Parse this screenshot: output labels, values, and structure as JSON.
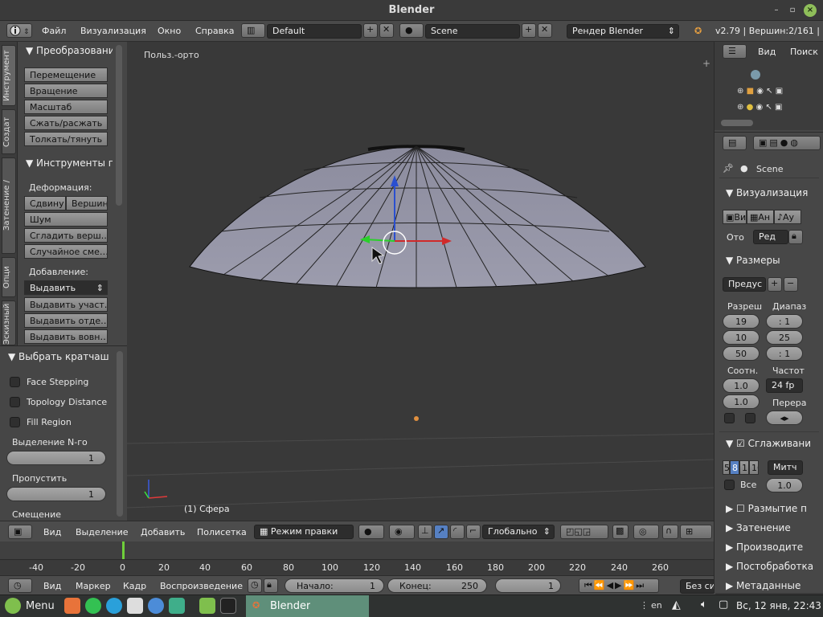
{
  "window": {
    "title": "Blender",
    "btn_min": "–",
    "btn_max": "▫",
    "btn_close": "×"
  },
  "menubar": {
    "info_icon": "info-icon",
    "menus": [
      "Файл",
      "Визуализация",
      "Окно",
      "Справка"
    ],
    "layout": "Default",
    "scene": "Scene",
    "engine": "Рендер Blender",
    "stats": "v2.79 | Вершин:2/161 | Ре"
  },
  "tabs": [
    "Инструмент",
    "Создат",
    "Затенение /",
    "Опци",
    "Эскизный каранд"
  ],
  "tools": {
    "transform_header": "Преобразовани",
    "transform_buttons": [
      "Перемещение",
      "Вращение",
      "Масштаб",
      "Сжать/расжать",
      "Толкать/тянуть"
    ],
    "mesh_header": "Инструменты по",
    "deform_label": "Деформация:",
    "deform_row": [
      "Сдвину",
      "Вершин"
    ],
    "deform_buttons": [
      "Шум",
      "Сгладить верш…",
      "Случайное сме…"
    ],
    "add_label": "Добавление:",
    "add_select": "Выдавить",
    "add_buttons": [
      "Выдавить участ…",
      "Выдавить отде…",
      "Выдавить вовн…"
    ]
  },
  "operator": {
    "header": "Выбрать кратчаш",
    "options": [
      "Face Stepping",
      "Topology Distance",
      "Fill Region"
    ],
    "nth_label": "Выделение N-го",
    "nth_value": "1",
    "skip_label": "Пропустить",
    "skip_value": "1",
    "offset_label": "Смещение"
  },
  "viewport": {
    "view_label": "Польз.-орто",
    "object_label": "(1) Сфера",
    "add_icon": "+"
  },
  "view3d_header": {
    "menus": [
      "Вид",
      "Выделение",
      "Добавить",
      "Полисетка"
    ],
    "mode": "Режим правки",
    "orientation": "Глобально"
  },
  "timeline": {
    "ticks": [
      "-40",
      "-20",
      "0",
      "20",
      "40",
      "60",
      "80",
      "100",
      "120",
      "140",
      "160",
      "180",
      "200",
      "220",
      "240",
      "260"
    ],
    "current_frame_marker": "0"
  },
  "timeline_header": {
    "menus": [
      "Вид",
      "Маркер",
      "Кадр",
      "Воспроизведение"
    ],
    "start_label": "Начало:",
    "start_value": "1",
    "end_label": "Конец:",
    "end_value": "250",
    "current": "1",
    "sync": "Без си"
  },
  "outliner": {
    "menus": [
      "Вид",
      "Поиск"
    ]
  },
  "properties": {
    "scene_name": "Scene",
    "render_header": "Визуализация",
    "render_buttons": [
      "Ви",
      "Ан",
      "Ау"
    ],
    "display_label": "Ото",
    "display_value": "Ред",
    "dims_header": "Размеры",
    "preset": "Предус",
    "res_label": "Разреш",
    "range_label": "Диапаз",
    "res_x": "19",
    "res_y": "10",
    "res_pct": "50",
    "frame_step1": ": 1",
    "frame_end": "25",
    "frame_step2": ": 1",
    "aspect_label": "Соотн.",
    "fps_label": "Частот",
    "aspect_x": "1.0",
    "aspect_y": "1.0",
    "fps": "24 fp",
    "remap_label": "Перера",
    "aa_header": "Сглаживани",
    "aa_samples": [
      "5",
      "8",
      "11",
      "16"
    ],
    "aa_filter": "Митч",
    "aa_full_label": "Все",
    "aa_full_value": "1.0",
    "collapsed": [
      "Размытие п",
      "Затенение",
      "Производите",
      "Постобработка",
      "Метаданные"
    ]
  },
  "taskbar": {
    "menu": "Menu",
    "app": "Blender",
    "lang": "en",
    "clock": "Вс, 12 янв, 22:43"
  },
  "colors": {
    "accent": "#5680c2",
    "taskbar_app": "#5f8f7a",
    "mint": "#7fbf4d"
  }
}
